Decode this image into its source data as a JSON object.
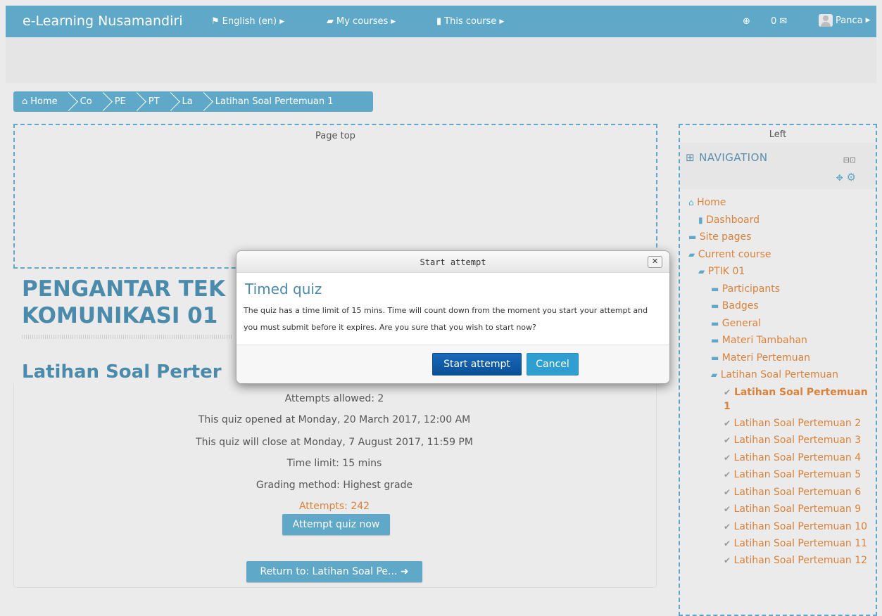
{
  "navbar": {
    "brand": "e-Learning Nusamandiri",
    "language": "English (en)",
    "my_courses": "My courses",
    "this_course": "This course",
    "messages_count": "0",
    "user": "Panca"
  },
  "breadcrumb": [
    "Home",
    "Co",
    "PE",
    "PT",
    "La",
    "Latihan Soal Pertemuan 1"
  ],
  "regions": {
    "page_top": "Page top",
    "left": "Left"
  },
  "main": {
    "course_title_line1": "PENGANTAR TEK",
    "course_title_line2": "KOMUNIKASI 01",
    "quiz_title": "Latihan Soal Perter",
    "attempts_allowed": "Attempts allowed: 2",
    "opened": "This quiz opened at Monday, 20 March 2017, 12:00 AM",
    "close": "This quiz will close at Monday, 7 August 2017, 11:59 PM",
    "time_limit": "Time limit: 15 mins",
    "grading": "Grading method: Highest grade",
    "attempts": "Attempts: 242",
    "attempt_button": "Attempt quiz now",
    "return_button": "Return to: Latihan Soal Pe..."
  },
  "navigation": {
    "title": "NAVIGATION",
    "items": [
      "Home",
      "Dashboard",
      "Site pages",
      "Current course",
      "PTIK 01",
      "Participants",
      "Badges",
      "General",
      "Materi Tambahan",
      "Materi Pertemuan",
      "Latihan Soal Pertemuan",
      "Latihan Soal Pertemuan 1",
      "Latihan Soal Pertemuan 2",
      "Latihan Soal Pertemuan 3",
      "Latihan Soal Pertemuan 4",
      "Latihan Soal Pertemuan 5",
      "Latihan Soal Pertemuan 6",
      "Latihan Soal Pertemuan 9",
      "Latihan Soal Pertemuan 10",
      "Latihan Soal Pertemuan 11",
      "Latihan Soal Pertemuan 12"
    ]
  },
  "modal": {
    "header": "Start attempt",
    "title": "Timed quiz",
    "text": "The quiz has a time limit of 15 mins. Time will count down from the moment you start your attempt and you must submit before it expires. Are you sure that you wish to start now?",
    "start_button": "Start attempt",
    "cancel_button": "Cancel"
  },
  "colors": {
    "accent": "#5fa8c8",
    "link": "#d9823b",
    "primary_button": "#0e5aa7"
  }
}
